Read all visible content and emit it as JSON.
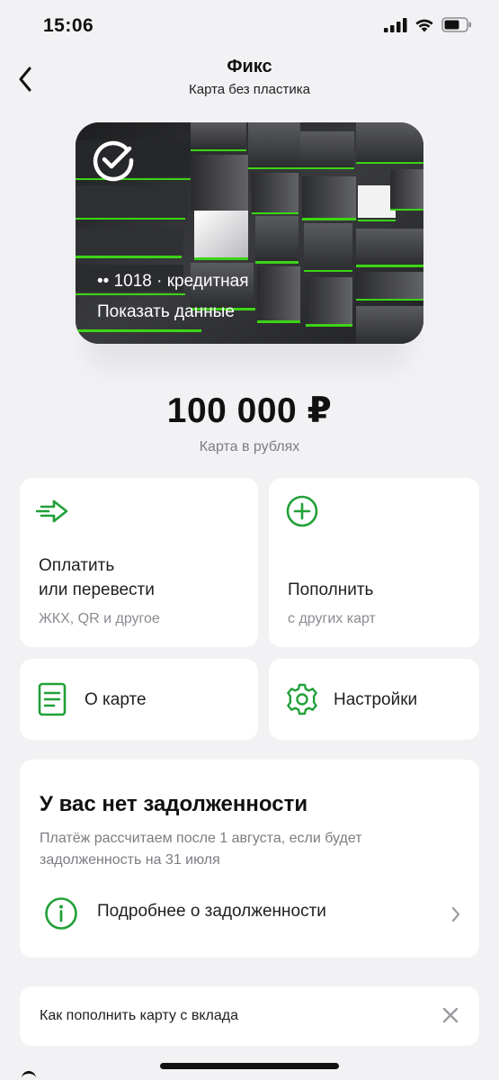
{
  "status_bar": {
    "time": "15:06",
    "icons": [
      "cellular-signal-icon",
      "wifi-icon",
      "battery-icon"
    ]
  },
  "header": {
    "back_icon": "chevron-left-icon",
    "title": "Фикс",
    "subtitle": "Карта без пластика"
  },
  "card": {
    "logo_icon": "sber-logo-icon",
    "number": "•• 1018 · кредитная",
    "show_data_label": "Показать данные",
    "accent_color": "#3cd416"
  },
  "balance": {
    "amount": "100 000 ₽",
    "caption": "Карта в рублях"
  },
  "actions": {
    "pay": {
      "icon": "pay-arrow-icon",
      "title_line1": "Оплатить",
      "title_line2": "или перевести",
      "subtitle": "ЖКХ, QR и другое"
    },
    "top_up": {
      "icon": "plus-circle-icon",
      "title": "Пополнить",
      "subtitle": "с других карт"
    },
    "about": {
      "icon": "document-icon",
      "title": "О карте"
    },
    "settings": {
      "icon": "gear-icon",
      "title": "Настройки"
    }
  },
  "debt": {
    "title": "У вас нет задолженности",
    "text": "Платёж рассчитаем после 1 августа, если будет задолженность на 31 июля",
    "link_icon": "info-circle-icon",
    "link_label": "Подробнее о задолженности",
    "chevron_icon": "chevron-right-icon"
  },
  "banner": {
    "label": "Как пополнить карту с вклада",
    "close_icon": "close-icon"
  },
  "colors": {
    "brand_green": "#21a038",
    "background": "#f2f2f4",
    "secondary_text": "#7b7d82"
  }
}
